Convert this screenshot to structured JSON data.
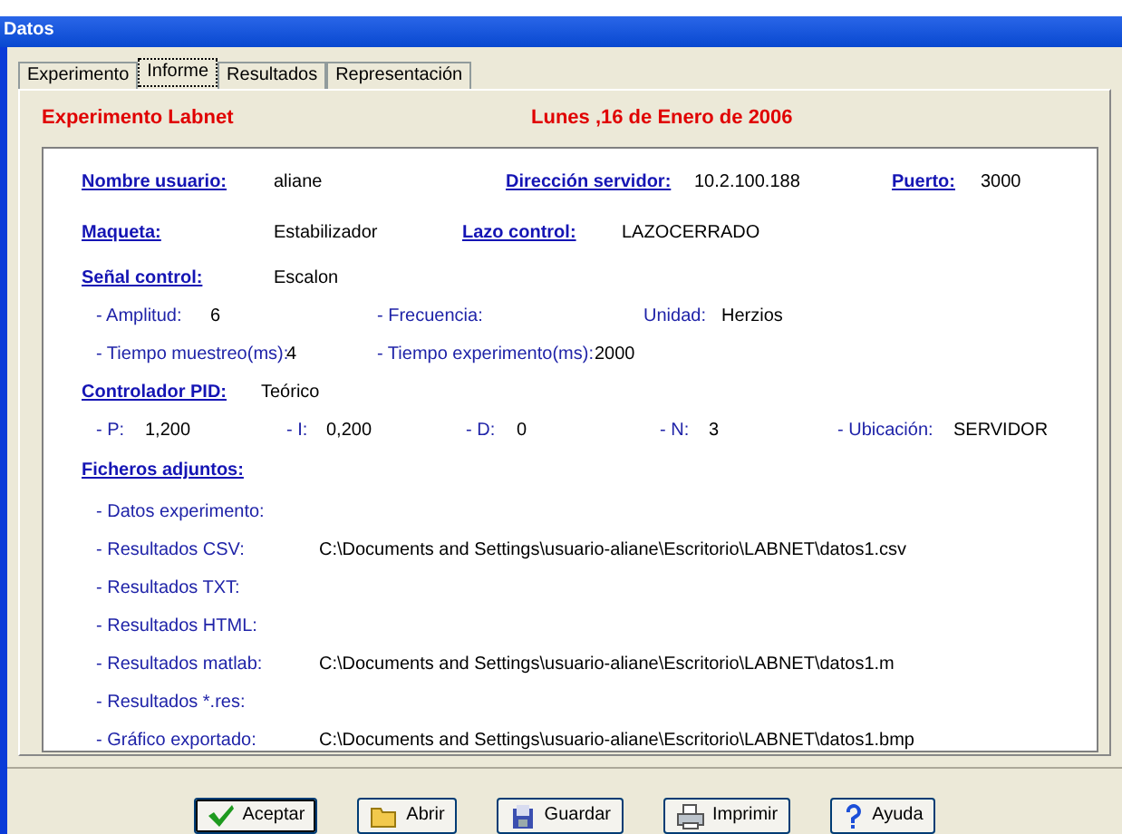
{
  "window": {
    "title": "Datos"
  },
  "tabs": [
    {
      "label": "Experimento",
      "selected": false
    },
    {
      "label": "Informe",
      "selected": true
    },
    {
      "label": "Resultados",
      "selected": false
    },
    {
      "label": "Representación",
      "selected": false
    }
  ],
  "header": {
    "title": "Experimento Labnet",
    "date": "Lunes ,16 de Enero de 2006"
  },
  "rows": [
    {
      "kind": "main",
      "items": [
        {
          "label": "Nombre usuario:",
          "value": "aliane"
        },
        {
          "label": "Dirección servidor:",
          "value": "10.2.100.188"
        },
        {
          "label": "Puerto:",
          "value": "3000"
        }
      ]
    },
    {
      "kind": "main",
      "items": [
        {
          "label": "Maqueta:",
          "value": "Estabilizador"
        },
        {
          "label": "Lazo control:",
          "value": "LAZOCERRADO"
        }
      ]
    },
    {
      "kind": "main",
      "items": [
        {
          "label": "Señal control:",
          "value": "Escalon"
        }
      ]
    },
    {
      "kind": "sub",
      "items": [
        {
          "label": "- Amplitud:",
          "value": "6"
        },
        {
          "label": "- Frecuencia:"
        },
        {
          "label": "Unidad:",
          "value": "Herzios"
        }
      ]
    },
    {
      "kind": "sub",
      "items": [
        {
          "label": "- Tiempo muestreo(ms):",
          "value": "4"
        },
        {
          "label": "- Tiempo experimento(ms):",
          "value": "2000"
        }
      ]
    },
    {
      "kind": "main",
      "items": [
        {
          "label": "Controlador PID:",
          "value": "Teórico"
        }
      ]
    },
    {
      "kind": "sub",
      "items": [
        {
          "label": "- P:",
          "value": "1,200"
        },
        {
          "label": "- I:",
          "value": "0,200"
        },
        {
          "label": "- D:",
          "value": "0"
        },
        {
          "label": "- N:",
          "value": "3"
        },
        {
          "label": "- Ubicación:",
          "value": "SERVIDOR"
        }
      ]
    }
  ],
  "attachments": {
    "heading": "Ficheros adjuntos:",
    "items": [
      {
        "label": "- Datos experimento:"
      },
      {
        "label": "- Resultados CSV:",
        "value": "C:\\Documents and Settings\\usuario-aliane\\Escritorio\\LABNET\\datos1.csv"
      },
      {
        "label": "- Resultados TXT:"
      },
      {
        "label": "- Resultados HTML:"
      },
      {
        "label": "- Resultados matlab:",
        "value": "C:\\Documents and Settings\\usuario-aliane\\Escritorio\\LABNET\\datos1.m"
      },
      {
        "label": "- Resultados *.res:"
      },
      {
        "label": "- Gráfico exportado:",
        "value": "C:\\Documents and Settings\\usuario-aliane\\Escritorio\\LABNET\\datos1.bmp"
      }
    ]
  },
  "buttons": [
    {
      "label": "Aceptar",
      "kind": "check",
      "default": true
    },
    {
      "label": "Abrir",
      "kind": "folder",
      "default": false
    },
    {
      "label": "Guardar",
      "kind": "disk",
      "default": false
    },
    {
      "label": "Imprimir",
      "kind": "printer",
      "default": false
    },
    {
      "label": "Ayuda",
      "kind": "help",
      "default": false
    }
  ]
}
